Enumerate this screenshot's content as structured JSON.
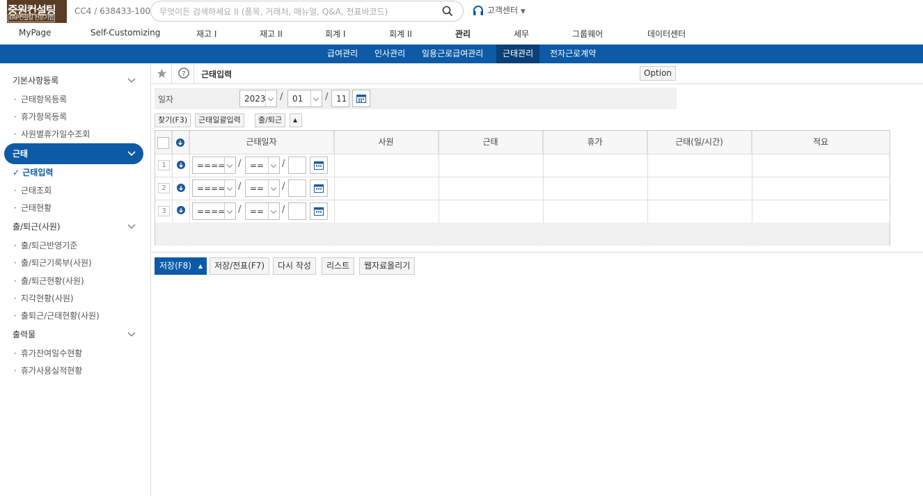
{
  "logo": {
    "line1": "중원컨설팅",
    "line2": "ERP컨설팅 전문기업"
  },
  "company": {
    "code": "CC4 / 638433-100"
  },
  "search": {
    "placeholder": "무엇이든 검색하세요 II (품목, 거래처, 매뉴얼, Q&A, 전표바코드)"
  },
  "customer_center": {
    "label": "고객센터"
  },
  "main_menu": [
    "MyPage",
    "Self-Customizing",
    "재고 I",
    "재고 II",
    "회계 I",
    "회계 II",
    "관리",
    "세무",
    "그룹웨어",
    "데이터센터"
  ],
  "main_menu_active": "관리",
  "sub_menu": [
    "급여관리",
    "인사관리",
    "일용근로급여관리",
    "근태관리",
    "전자근로계약"
  ],
  "sub_menu_active": "근태관리",
  "sidebar": {
    "group1": {
      "label": "기본사항등록",
      "items": [
        "근태항목등록",
        "휴가항목등록",
        "사원별휴가일수조회"
      ]
    },
    "group2": {
      "label": "근태",
      "items": [
        "근태입력",
        "근태조회",
        "근태현황"
      ]
    },
    "group3": {
      "label": "출/퇴근(사원)",
      "items": [
        "출/퇴근반영기준",
        "출/퇴근기록부(사원)",
        "출/퇴근현황(사원)",
        "지각현황(사원)",
        "출퇴근/근태현황(사원)"
      ]
    },
    "group4": {
      "label": "출력물",
      "items": [
        "휴가잔여일수현황",
        "휴가사용실적현황"
      ]
    }
  },
  "page": {
    "title": "근태입력",
    "option_label": "Option"
  },
  "date": {
    "label": "일자",
    "year": "2023",
    "month": "01",
    "day": "11"
  },
  "toolbar": {
    "find": "찾기(F3)",
    "bulk": "근태일괄입력",
    "inout": "출/퇴근"
  },
  "grid": {
    "headers": [
      "근태일자",
      "사원",
      "근태",
      "휴가",
      "근태(일/시간)",
      "적요"
    ],
    "rows": [
      {
        "num": "1",
        "year": "====",
        "month": "=="
      },
      {
        "num": "2",
        "year": "====",
        "month": "=="
      },
      {
        "num": "3",
        "year": "====",
        "month": "=="
      }
    ]
  },
  "bottom": {
    "save": "저장(F8)",
    "save_slip": "저장/전표(F7)",
    "rewrite": "다시 작성",
    "list": "리스트",
    "upload": "웹자료올리기"
  },
  "colors": {
    "primary": "#0d5aa7",
    "active_sub": "#0a3f77"
  }
}
